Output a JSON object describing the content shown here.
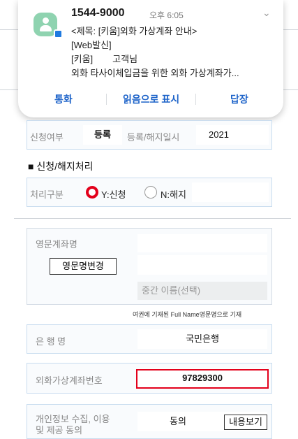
{
  "notification": {
    "sender": "1544-9000",
    "time": "오후 6:05",
    "lines": [
      "<제목: [키움]외화 가상계좌 안내>",
      "[Web발신]",
      "[키움]",
      "고객님",
      "외화 타사이체입금을 위한 외화 가상계좌가..."
    ],
    "actions": [
      "통화",
      "읽음으로 표시",
      "답장"
    ]
  },
  "status_row": {
    "label": "신청여부",
    "status": "등록",
    "date_label": "등록/해지일시",
    "date_value": "2021"
  },
  "section": {
    "title": "■ 신청/해지처리"
  },
  "process": {
    "label": "처리구분",
    "option_apply": "Y:신청",
    "option_cancel": "N:해지",
    "selected": "Y:신청"
  },
  "english_name": {
    "label": "영문계좌명",
    "change_button": "영문명변경",
    "middle_placeholder": "중간 이름(선택)",
    "note": "여권에 기재된 Full Name영문명으로 기재"
  },
  "bank": {
    "label": "은 행 명",
    "value": "국민은행"
  },
  "account": {
    "label": "외화가상계좌번호",
    "value": "97829300"
  },
  "privacy": {
    "label_line1": "개인정보 수집, 이용",
    "label_line2": "및 제공 동의",
    "value": "동의",
    "view_button": "내용보기"
  },
  "colors": {
    "accent_red": "#e3001b",
    "action_blue": "#1d63c9",
    "box_border": "#c8dcef"
  }
}
